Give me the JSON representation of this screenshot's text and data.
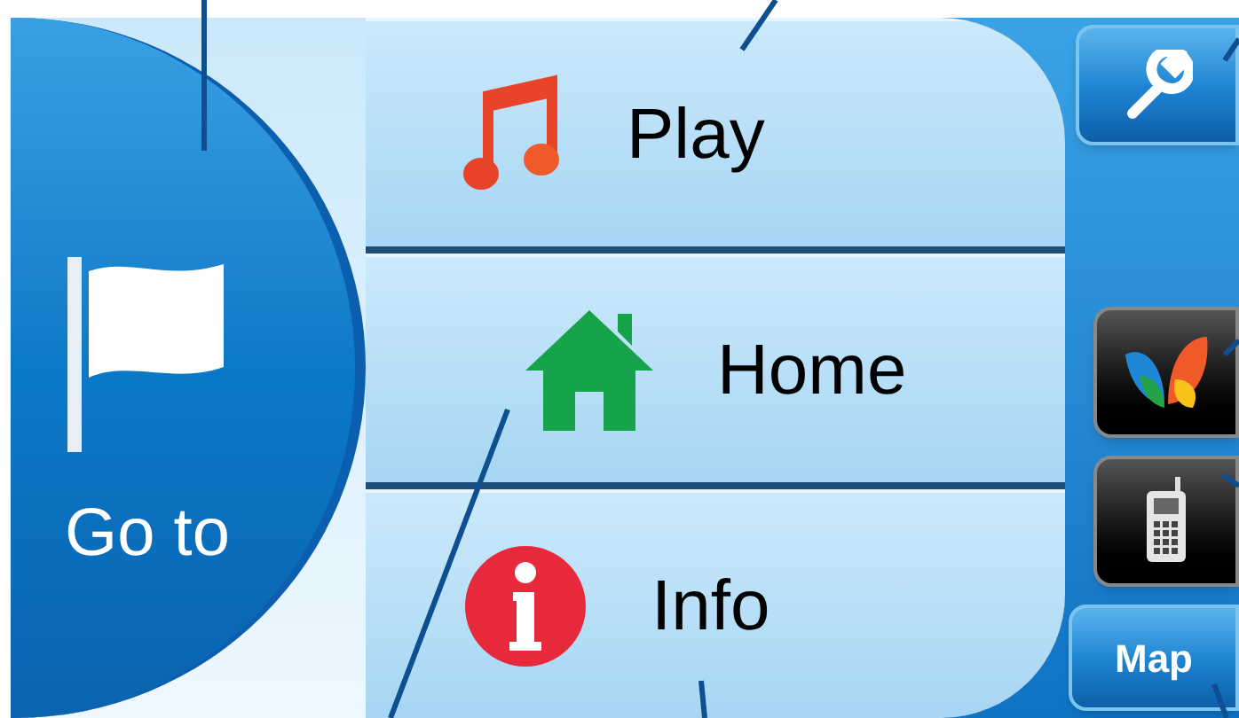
{
  "goto_button": {
    "label": "Go to"
  },
  "menu_items": [
    {
      "kind": "music",
      "label": "Play"
    },
    {
      "kind": "home",
      "label": "Home"
    },
    {
      "kind": "info",
      "label": "Info"
    }
  ],
  "side_buttons": [
    {
      "kind": "settings"
    },
    {
      "kind": "spacer"
    },
    {
      "kind": "butterfly"
    },
    {
      "kind": "phone"
    },
    {
      "kind": "text",
      "label": "Map"
    }
  ]
}
